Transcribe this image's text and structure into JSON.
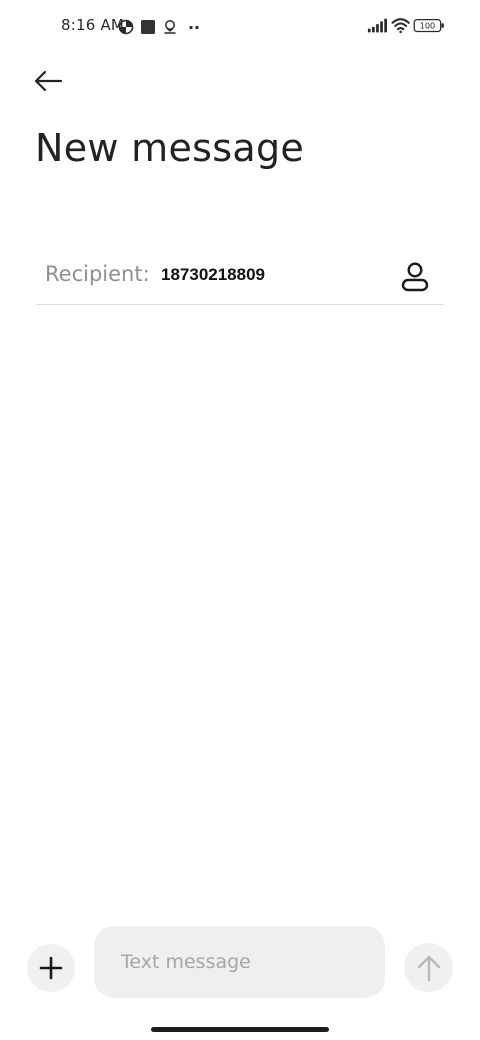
{
  "status_bar": {
    "time": "8:16 AM",
    "battery_level": "100",
    "left_icons": [
      "data-saver-icon",
      "stop-square-icon",
      "location-pin-icon",
      "more-dots-icon"
    ],
    "right_icons": [
      "cellular-signal-icon",
      "wifi-icon",
      "battery-icon"
    ]
  },
  "header": {
    "back_icon": "arrow-left-icon",
    "title": "New message"
  },
  "recipient": {
    "label": "Recipient:",
    "value": "18730218809",
    "contact_icon": "person-icon"
  },
  "composer": {
    "add_icon": "plus-icon",
    "placeholder": "Text message",
    "value": "",
    "send_icon": "arrow-up-icon"
  },
  "colors": {
    "background": "#ffffff",
    "text_primary": "#222222",
    "text_muted": "#8f8f8f",
    "placeholder": "#a6a6a6",
    "input_bg": "#efefef",
    "button_bg": "#f0f0f0",
    "divider": "#dedede"
  }
}
